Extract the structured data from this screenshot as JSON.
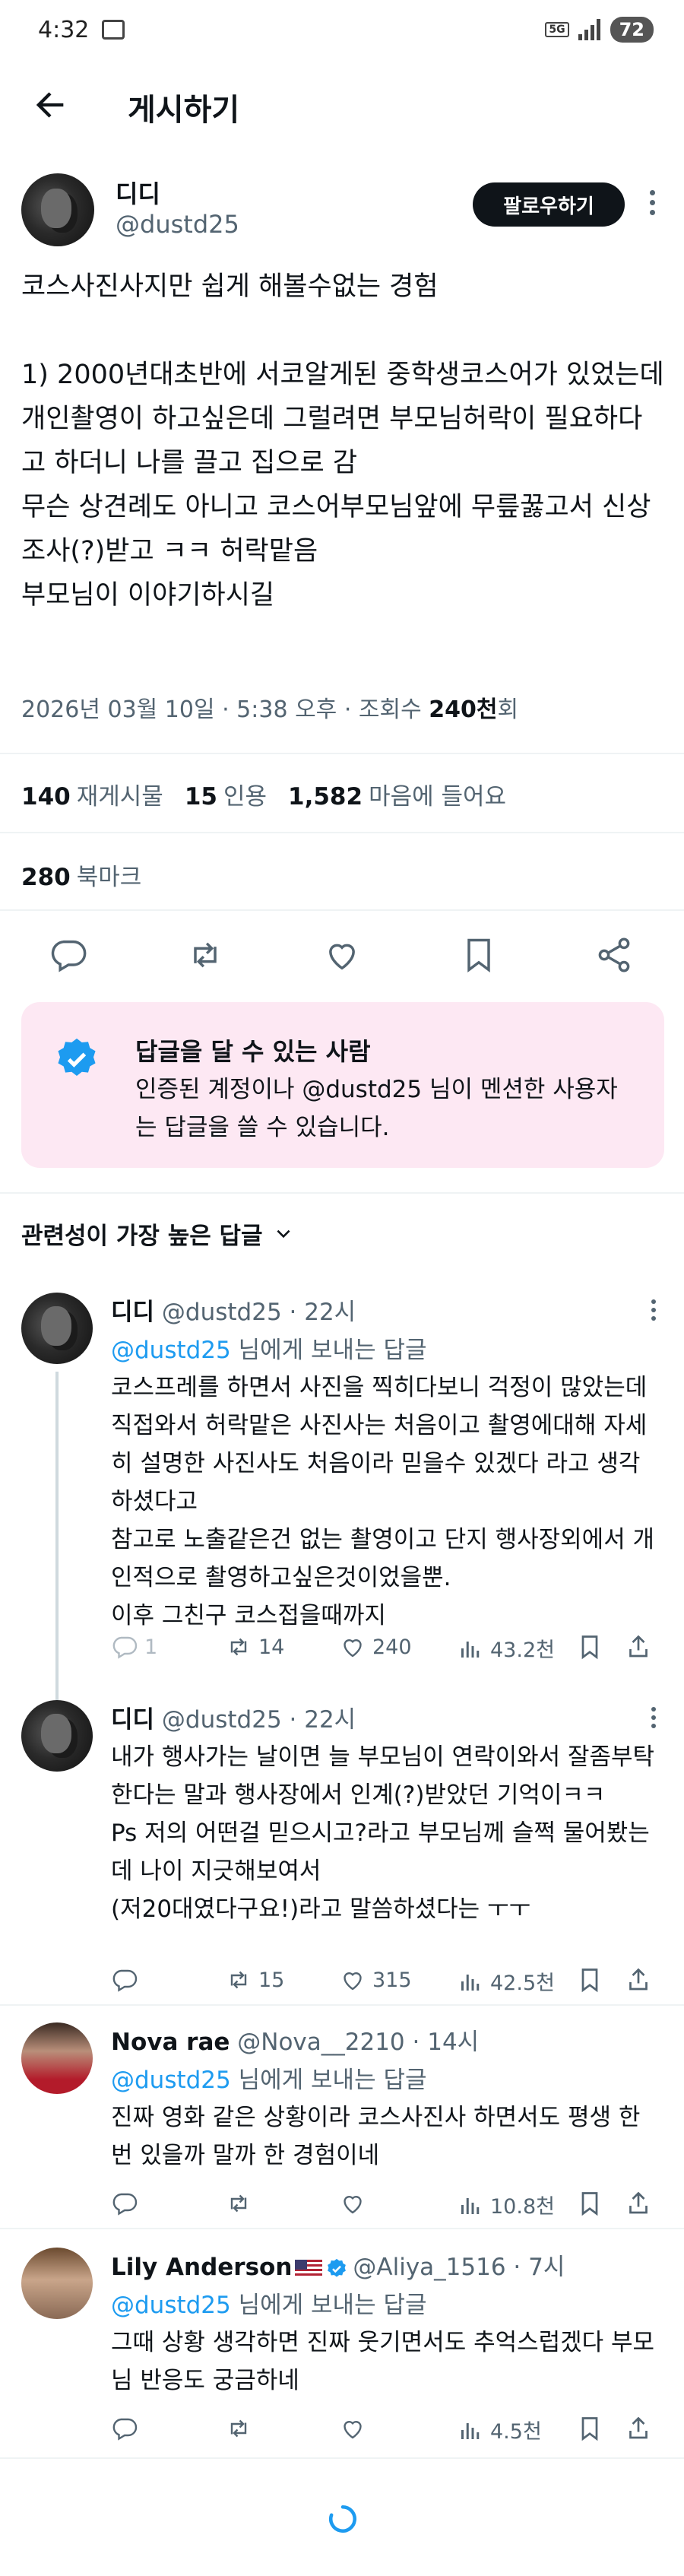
{
  "status_bar": {
    "time": "4:32",
    "network": "5G",
    "battery": "72"
  },
  "header": {
    "title": "게시하기"
  },
  "post": {
    "author_name": "디디",
    "author_handle": "@dustd25",
    "follow_label": "팔로우하기",
    "text": "코스사진사지만 쉽게 해볼수없는 경험\n\n1) 2000년대초반에 서코알게된 중학생코스어가 있었는데 개인촬영이 하고싶은데 그럴려면 부모님허락이 필요하다고 하더니 나를 끌고 집으로 감\n무슨 상견례도 아니고 코스어부모님앞에 무릎꿇고서 신상조사(?)받고 ㅋㅋ 허락맡음\n부모님이 이야기하시길",
    "date": "2026년 03월 10일 · 5:38 오후 · 조회수 ",
    "views": "240천",
    "views_suffix": "회"
  },
  "stats": {
    "reposts": "140",
    "reposts_label": "재게시물",
    "quotes": "15",
    "quotes_label": "인용",
    "likes": "1,582",
    "likes_label": "마음에 들어요",
    "bookmarks": "280",
    "bookmarks_label": "북마크"
  },
  "reply_box": {
    "title": "답글을 달 수 있는 사람",
    "text": "인증된 계정이나 @dustd25 님이 멘션한 사용자는 답글을 쓸 수 있습니다."
  },
  "sort": {
    "label": "관련성이 가장 높은 답글"
  },
  "replies": [
    {
      "name": "디디",
      "handle": "@dustd25 · 22시",
      "to_mention": "@dustd25",
      "to_suffix": " 님에게 보내는 답글",
      "text": "코스프레를 하면서 사진을 찍히다보니 걱정이 많았는데 직접와서 허락맡은 사진사는 처음이고 촬영에대해 자세히 설명한 사진사도 처음이라 믿을수 있겠다 라고 생각하셨다고\n참고로 노출같은건 없는 촬영이고 단지 행사장외에서 개인적으로 촬영하고싶은것이었을뿐.\n이후 그친구 코스접을때까지",
      "replies": "1",
      "reposts": "14",
      "likes": "240",
      "views": "43.2천"
    },
    {
      "name": "디디",
      "handle": "@dustd25 · 22시",
      "text": "내가 행사가는 날이면 늘 부모님이 연락이와서 잘좀부탁한다는 말과 행사장에서 인계(?)받았던 기억이ㅋㅋ\nPs 저의 어떤걸 믿으시고?라고 부모님께 슬쩍 물어봤는데 나이 지긋해보여서\n(저20대였다구요!)라고 말씀하셨다는 ㅜㅜ",
      "replies": "",
      "reposts": "15",
      "likes": "315",
      "views": "42.5천"
    },
    {
      "name": "Nova rae",
      "handle": "@Nova__2210 · 14시",
      "to_mention": "@dustd25",
      "to_suffix": " 님에게 보내는 답글",
      "text": "진짜 영화 같은 상황이라 코스사진사 하면서도 평생 한 번 있을까 말까 한 경험이네",
      "replies": "",
      "reposts": "",
      "likes": "",
      "views": "10.8천"
    },
    {
      "name": "Lily Anderson",
      "handle": "@Aliya_1516 · 7시",
      "to_mention": "@dustd25",
      "to_suffix": " 님에게 보내는 답글",
      "text": "그때 상황 생각하면 진짜 웃기면서도 추억스럽겠다 부모님 반응도 궁금하네",
      "replies": "",
      "reposts": "",
      "likes": "",
      "views": "4.5천"
    }
  ]
}
